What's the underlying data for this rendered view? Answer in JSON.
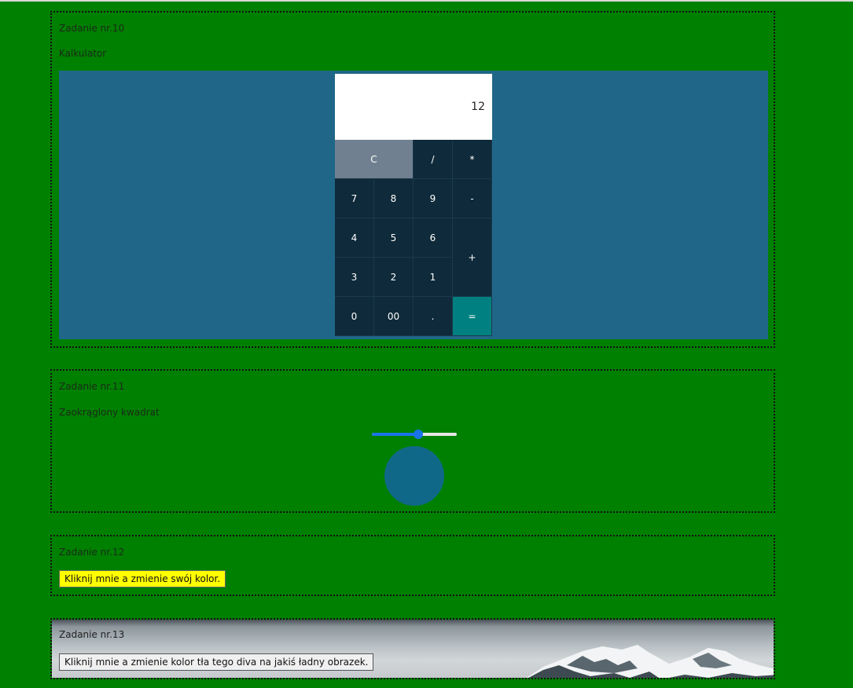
{
  "tasks": {
    "t10": {
      "title": "Zadanie nr.10",
      "subtitle": "Kalkulator"
    },
    "t11": {
      "title": "Zadanie nr.11",
      "subtitle": "Zaokrąglony kwadrat"
    },
    "t12": {
      "title": "Zadanie nr.12",
      "button": "Kliknij mnie a zmienie swój kolor."
    },
    "t13": {
      "title": "Zadanie nr.13",
      "button": "Kliknij mnie a zmienie kolor tła tego diva na jakiś ładny obrazek."
    }
  },
  "calculator": {
    "display": "12",
    "keys": {
      "clear": "C",
      "divide": "/",
      "multiply": "*",
      "k7": "7",
      "k8": "8",
      "k9": "9",
      "minus": "-",
      "k4": "4",
      "k5": "5",
      "k6": "6",
      "plus": "+",
      "k3": "3",
      "k2": "2",
      "k1": "1",
      "k0": "0",
      "k00": "00",
      "dot": ".",
      "equals": "="
    }
  },
  "slider": {
    "value": 0.55
  },
  "colors": {
    "page_bg": "#008000",
    "calc_area": "#206688",
    "key_bg": "#0f2a3a",
    "clear_bg": "#708090",
    "equals_bg": "#008080",
    "circle": "#106888",
    "button12_bg": "#ffff00"
  }
}
